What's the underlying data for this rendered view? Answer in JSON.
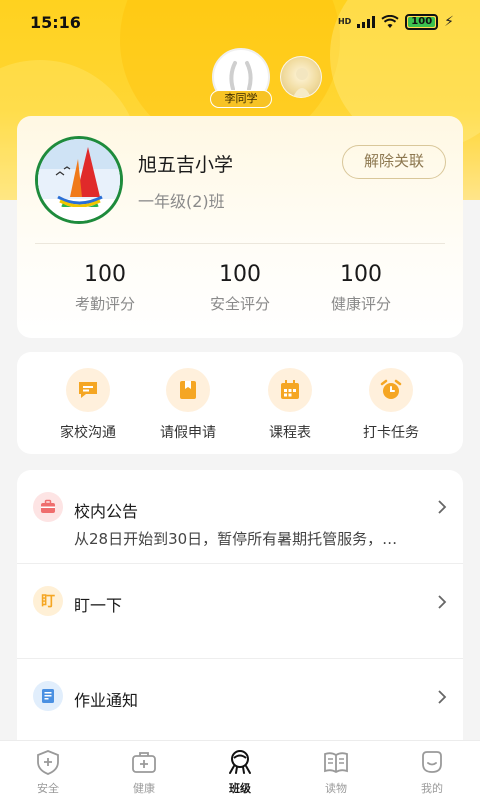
{
  "status_bar": {
    "time": "15:16",
    "network_badge": "HD",
    "battery": "100"
  },
  "profile": {
    "student_name": "李同学"
  },
  "school": {
    "name": "旭五吉小学",
    "class": "一年级(2)班",
    "unbind_label": "解除关联",
    "scores": [
      {
        "value": "100",
        "label": "考勤评分"
      },
      {
        "value": "100",
        "label": "安全评分"
      },
      {
        "value": "100",
        "label": "健康评分"
      }
    ]
  },
  "actions": [
    {
      "label": "家校沟通",
      "icon": "chat-icon"
    },
    {
      "label": "请假申请",
      "icon": "leave-icon"
    },
    {
      "label": "课程表",
      "icon": "calendar-icon"
    },
    {
      "label": "打卡任务",
      "icon": "alarm-clock-icon"
    }
  ],
  "list": {
    "notice": {
      "title": "校内公告",
      "subtitle": "从28日开始到30日，暂停所有暑期托管服务，…",
      "icon": "briefcase-icon"
    },
    "ding": {
      "title": "盯一下",
      "icon_text": "盯"
    },
    "homework": {
      "title": "作业通知",
      "icon": "document-icon"
    }
  },
  "nav": [
    {
      "label": "安全",
      "icon": "shield-icon"
    },
    {
      "label": "健康",
      "icon": "medical-kit-icon"
    },
    {
      "label": "班级",
      "icon": "class-icon",
      "active": true
    },
    {
      "label": "读物",
      "icon": "book-icon"
    },
    {
      "label": "我的",
      "icon": "profile-icon"
    }
  ],
  "colors": {
    "brand_yellow": "#ffd21f",
    "action_orange": "#f5a623",
    "notice_red": "#ef6d6d",
    "homework_blue": "#4a90e2"
  }
}
